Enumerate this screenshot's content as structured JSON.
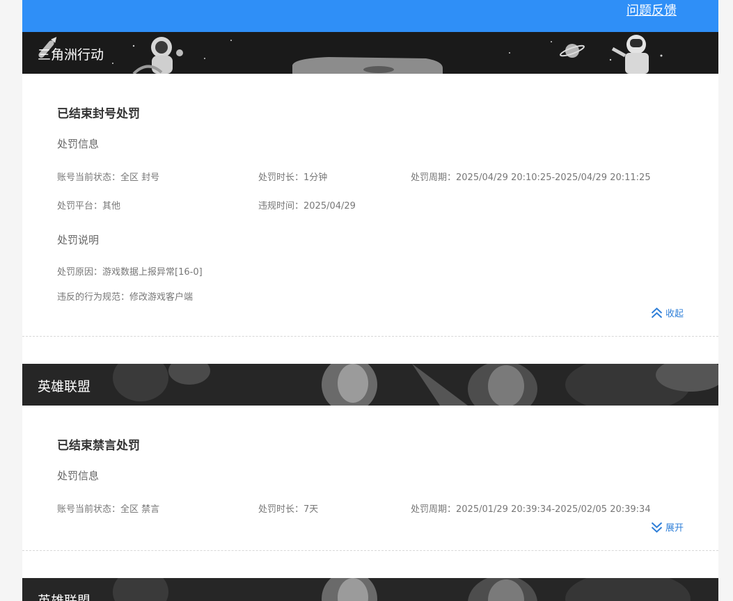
{
  "header": {
    "feedback_label": "问题反馈",
    "accent": "#2f8ff7"
  },
  "records": [
    {
      "game": "三角洲行动",
      "status_title": "已结束封号处罚",
      "info_heading": "处罚信息",
      "current_status_label": "账号当前状态：",
      "current_status_value": "全区 封号",
      "duration_label": "处罚时长：",
      "duration_value": "1分钟",
      "period_label": "处罚周期：",
      "period_value": "2025/04/29 20:10:25-2025/04/29 20:11:25",
      "platform_label": "处罚平台：",
      "platform_value": "其他",
      "violation_time_label": "违规时间：",
      "violation_time_value": "2025/04/29",
      "explain_heading": "处罚说明",
      "reason_label": "处罚原因：",
      "reason_value": "游戏数据上报异常[16-0]",
      "rule_label": "违反的行为规范：",
      "rule_value": "修改游戏客户端",
      "toggle_label": "收起",
      "toggle_icon": "double-chevron-up-icon"
    },
    {
      "game": "英雄联盟",
      "status_title": "已结束禁言处罚",
      "info_heading": "处罚信息",
      "current_status_label": "账号当前状态：",
      "current_status_value": "全区 禁言",
      "duration_label": "处罚时长：",
      "duration_value": "7天",
      "period_label": "处罚周期：",
      "period_value": "2025/01/29 20:39:34-2025/02/05 20:39:34",
      "toggle_label": "展开",
      "toggle_icon": "double-chevron-down-icon"
    },
    {
      "game": "英雄联盟"
    }
  ]
}
